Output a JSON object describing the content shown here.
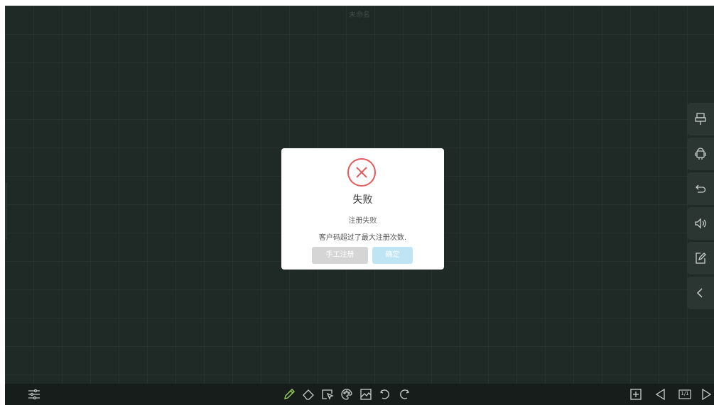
{
  "window": {
    "title": "未命名"
  },
  "dialog": {
    "title": "失败",
    "subtitle": "注册失败",
    "message": "客户码超过了最大注册次数.",
    "manual_button": "手工注册",
    "ok_button": "确定"
  },
  "side_panel": [
    "usb-icon",
    "android-icon",
    "back-icon",
    "volume-icon",
    "edit-icon",
    "collapse-icon"
  ],
  "toolbar": {
    "left": [
      "settings-sliders-icon"
    ],
    "center": [
      "pen-icon",
      "eraser-icon",
      "select-icon",
      "palette-icon",
      "image-icon",
      "undo-icon",
      "redo-icon"
    ],
    "page_indicator": "1/1"
  },
  "colors": {
    "background": "#1f2a26",
    "toolbar": "#161d1a",
    "error": "#e45a5a",
    "ok_button": "#bfe5f5"
  }
}
